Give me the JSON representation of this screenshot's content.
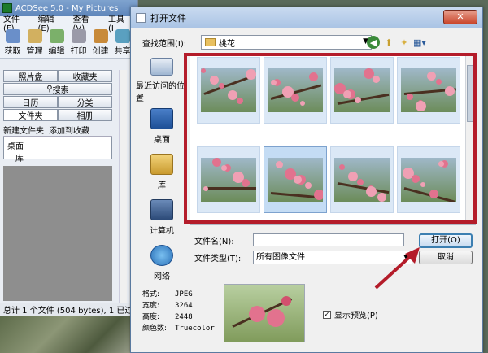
{
  "acdsee": {
    "title": "ACDSee 5.0 - My Pictures",
    "menu": [
      "文件(F)",
      "编辑(E)",
      "查看(V)",
      "工具(I"
    ],
    "toolbar": [
      "获取",
      "管理",
      "编辑",
      "打印",
      "创建",
      "共享"
    ],
    "tabs": {
      "photo_disc": "照片盘",
      "favorites": "收藏夹",
      "search": "搜索",
      "calendar": "日历",
      "category": "分类",
      "folders": "文件夹",
      "album": "相册"
    },
    "tasks": [
      "新建文件夹",
      "添加到收藏"
    ],
    "tree": [
      "桌面",
      "库"
    ],
    "status": "总计 1 个文件 (504 bytes), 1 已过滤"
  },
  "dialog": {
    "title": "打开文件",
    "close_label": "✕",
    "lookin_label": "查找范围(I):",
    "lookin_value": "桃花",
    "places": [
      {
        "label": "最近访问的位置",
        "icon": "recent-places-icon"
      },
      {
        "label": "桌面",
        "icon": "desktop-icon"
      },
      {
        "label": "库",
        "icon": "library-icon"
      },
      {
        "label": "计算机",
        "icon": "computer-icon"
      },
      {
        "label": "网络",
        "icon": "network-icon"
      }
    ],
    "filename_label": "文件名(N):",
    "filename_value": "",
    "filetype_label": "文件类型(T):",
    "filetype_value": "所有图像文件",
    "open_label": "打开(O)",
    "cancel_label": "取消",
    "info": {
      "format_label": "格式:",
      "format_value": "JPEG",
      "width_label": "宽度:",
      "width_value": "3264",
      "height_label": "高度:",
      "height_value": "2448",
      "colors_label": "颜色数:",
      "colors_value": "Truecolor"
    },
    "preview_label": "显示预览(P)",
    "preview_checked": true,
    "thumbnail_count": 8,
    "highlight_color": "#b41c2a"
  }
}
